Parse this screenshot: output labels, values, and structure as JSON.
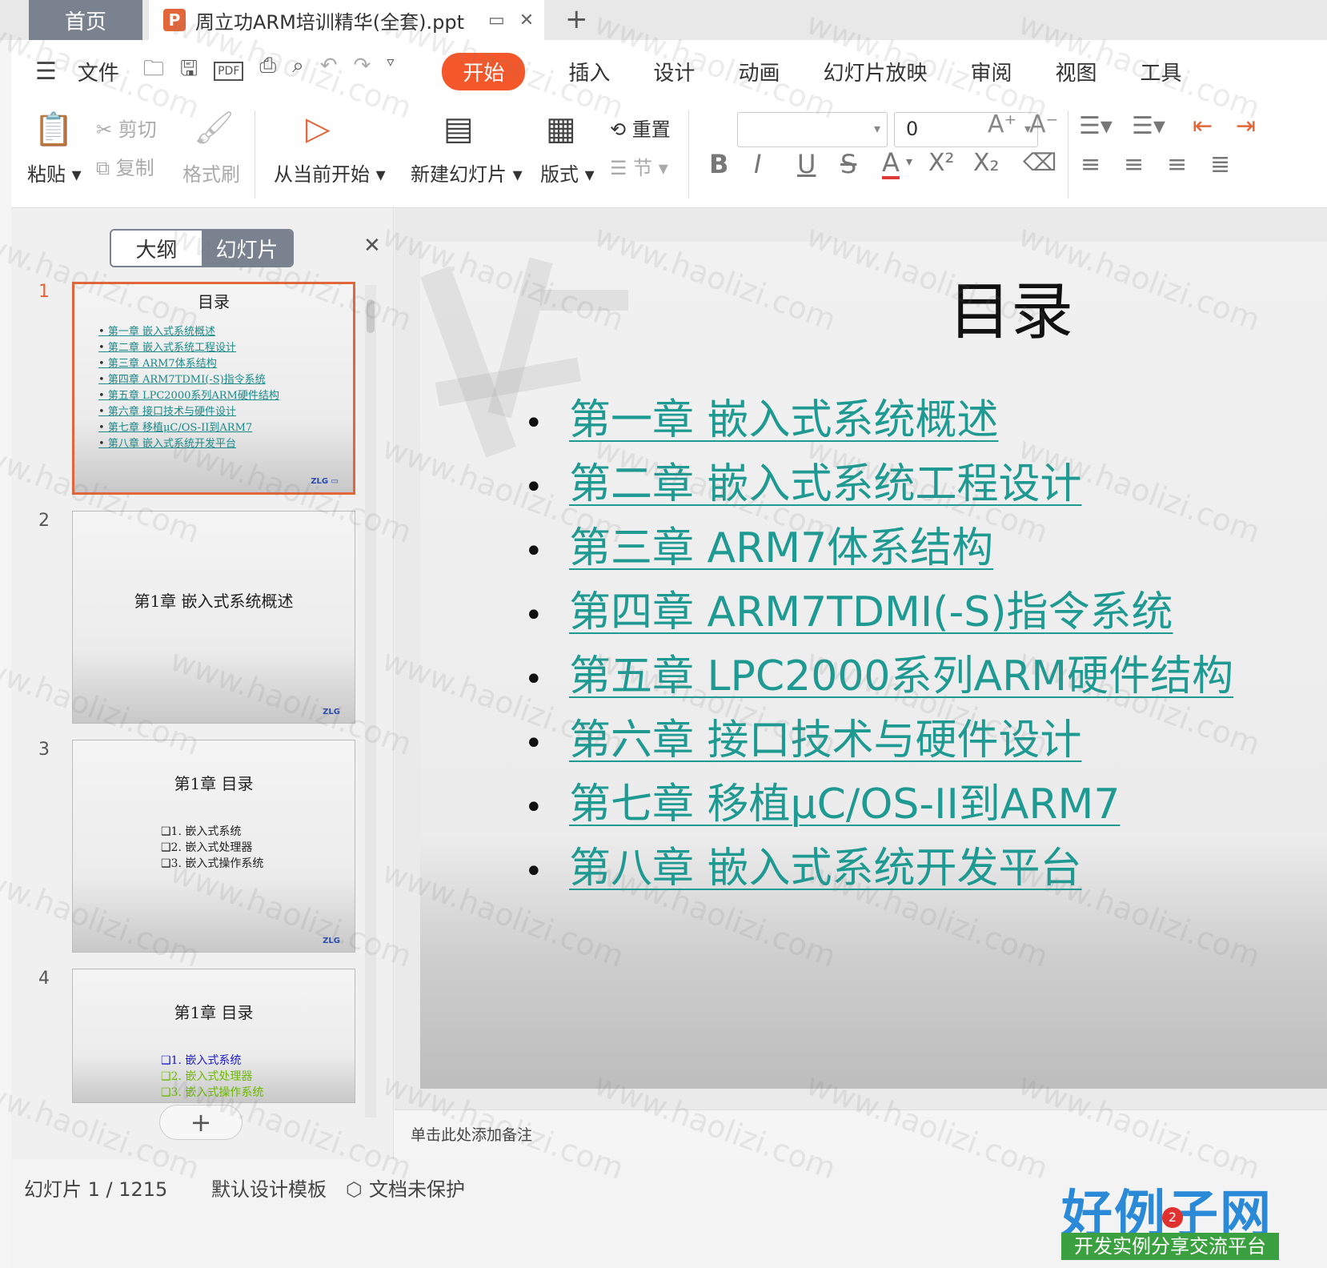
{
  "tabs": {
    "home": "首页",
    "document": "周立功ARM培训精华(全套).ppt",
    "add": "+"
  },
  "menu": {
    "file": "文件",
    "tabs": [
      "开始",
      "插入",
      "设计",
      "动画",
      "幻灯片放映",
      "审阅",
      "视图",
      "工具"
    ],
    "active_tab": "开始"
  },
  "ribbon": {
    "paste": "粘贴",
    "cut": "剪切",
    "copy": "复制",
    "format_painter": "格式刷",
    "play_from_current": "从当前开始",
    "new_slide": "新建幻灯片",
    "layout": "版式",
    "reset": "重置",
    "section": "节",
    "font_name": "",
    "font_size": "0"
  },
  "left_panel": {
    "outline_tab": "大纲",
    "slides_tab": "幻灯片",
    "active_view": "幻灯片",
    "thumbnails": [
      {
        "number": "1",
        "title": "目录",
        "items": [
          "第一章 嵌入式系统概述",
          "第二章 嵌入式系统工程设计",
          "第三章 ARM7体系结构",
          "第四章 ARM7TDMI(-S)指令系统",
          "第五章 LPC2000系列ARM硬件结构",
          "第六章 接口技术与硬件设计",
          "第七章 移植μC/OS-II到ARM7",
          "第八章 嵌入式系统开发平台"
        ]
      },
      {
        "number": "2",
        "title": "第1章  嵌入式系统概述"
      },
      {
        "number": "3",
        "title": "第1章  目录",
        "items": [
          "❑1. 嵌入式系统",
          "❑2. 嵌入式处理器",
          "❑3. 嵌入式操作系统"
        ]
      },
      {
        "number": "4",
        "title": "第1章  目录",
        "items": [
          "❑1. 嵌入式系统",
          "❑2. 嵌入式处理器",
          "❑3. 嵌入式操作系统"
        ]
      }
    ],
    "add_slide": "+"
  },
  "slide": {
    "title": "目录",
    "items": [
      "第一章 嵌入式系统概述",
      "第二章 嵌入式系统工程设计",
      "第三章 ARM7体系结构",
      "第四章 ARM7TDMI(-S)指令系统",
      "第五章 LPC2000系列ARM硬件结构",
      "第六章 接口技术与硬件设计",
      "第七章 移植μC/OS-II到ARM7",
      "第八章 嵌入式系统开发平台"
    ],
    "link_color": "#1f9a93"
  },
  "notes": {
    "placeholder": "单击此处添加备注"
  },
  "status": {
    "slide_counter": "幻灯片 1 / 1215",
    "template": "默认设计模板",
    "protection": "文档未保护"
  },
  "watermark": "www.haolizi.com",
  "brand": {
    "main": "好例子网",
    "sub": "开发实例分享交流平台",
    "badge": "2"
  },
  "colors": {
    "accent": "#f4582a",
    "tab_home": "#7a8290",
    "link": "#1f9a93"
  }
}
